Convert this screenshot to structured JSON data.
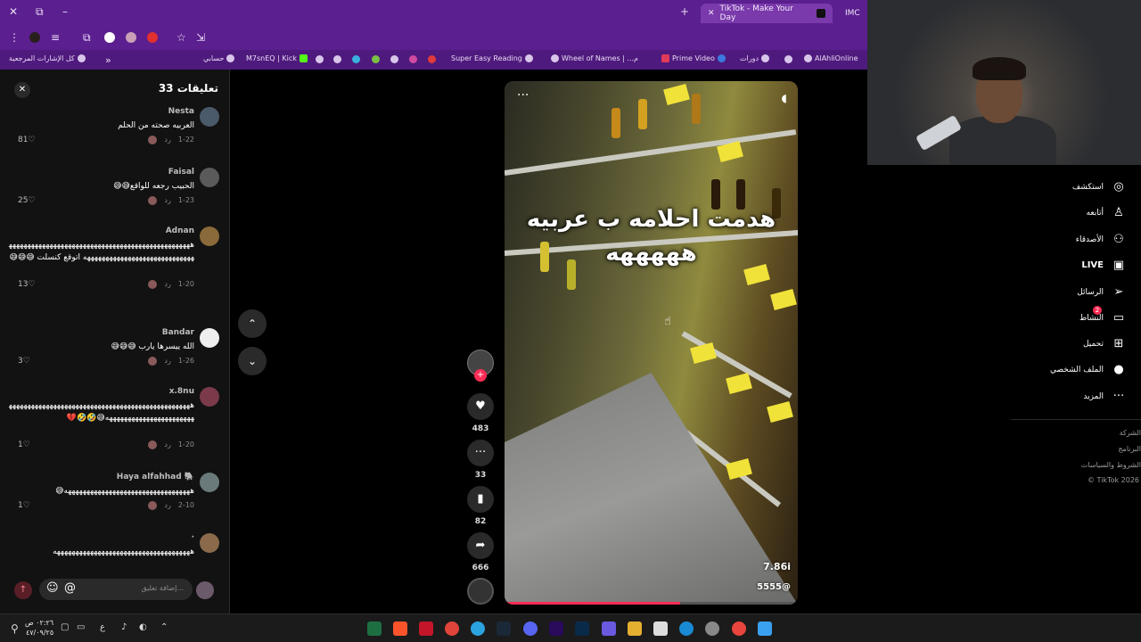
{
  "browser": {
    "active_tab_title": "TikTok - Make Your Day",
    "inactive_tab_title": "IMC",
    "window_controls": {
      "close": "✕",
      "restore": "⧉",
      "minimize": "–",
      "new_tab": "+"
    },
    "bookmarks": [
      "كل الإشارات المرجعية",
      "حسابي",
      "M7snEQ | Kick",
      "Super Easy Reading",
      "Wheel of Names | ...م",
      "Prime Video",
      "دورات",
      "AlAhliOnline"
    ],
    "bookmarks_overflow": "»"
  },
  "comments_panel": {
    "title": "تعليقات 33",
    "close": "✕",
    "reply_label": "رد",
    "items": [
      {
        "name": "Nesta",
        "text": "العربيه صحته من الحلم",
        "date": "1-22",
        "likes": "81",
        "avatar_color": "#4a5a6a"
      },
      {
        "name": "Faisal",
        "text": "الحبيب رجعه للواقع😅😅",
        "date": "1-23",
        "likes": "25",
        "avatar_color": "#5a5a5a"
      },
      {
        "name": "Adnan",
        "text": "هههههههههههههههههههههههههههههههههههههههههههههههههههههههههههههههههههههههههههههههه اتوقع كنسلت 😅😅😅",
        "date": "1-20",
        "likes": "13",
        "avatar_color": "#8a6a3a"
      },
      {
        "name": "Bandar",
        "text": "الله ييسرها يارب 😅😅😅",
        "date": "1-26",
        "likes": "3",
        "avatar_color": "#eeeeee"
      },
      {
        "name": "x.8nu",
        "text": "هههههههههههههههههههههههههههههههههههههههههههههههههههههههههههههههههههههههههه😅🤣🤣💔",
        "date": "1-20",
        "likes": "1",
        "avatar_color": "#7a3a4a"
      },
      {
        "name": "Haya alfahhad 🐘",
        "text": "ههههههههههههههههههههههههههههههههههه😅",
        "date": "2-10",
        "likes": "1",
        "avatar_color": "#6a7a7a"
      },
      {
        "name": "·",
        "text": "هههههههههههههههههههههههههههههههههههههه",
        "date": "",
        "likes": "",
        "avatar_color": "#8a6a4a"
      }
    ],
    "input_placeholder": "إضافة تعليق...",
    "at_symbol": "@",
    "emoji_symbol": "☺",
    "send_symbol": "↑"
  },
  "nav": {
    "up": "⌃",
    "down": "⌄"
  },
  "video": {
    "caption_line1": "هدمت احلامه ب عربيه",
    "caption_line2": "هههههه",
    "view_count": "7.86i",
    "username": "5555@",
    "more": "···",
    "progress": 0.6,
    "likes": "483",
    "comments": "33",
    "saves": "82",
    "shares": "666"
  },
  "right_nav": {
    "items": [
      {
        "label": "استكشف",
        "icon": "compass-icon",
        "glyph": "◎"
      },
      {
        "label": "أتابعه",
        "icon": "user-follow-icon",
        "glyph": "♙"
      },
      {
        "label": "الأصدقاء",
        "icon": "friends-icon",
        "glyph": "⚇"
      },
      {
        "label": "LIVE",
        "icon": "live-tv-icon",
        "glyph": "▣"
      },
      {
        "label": "الرسائل",
        "icon": "send-icon",
        "glyph": "➢"
      },
      {
        "label": "النشاط",
        "icon": "activity-icon",
        "glyph": "▭"
      },
      {
        "label": "تحميل",
        "icon": "upload-icon",
        "glyph": "⊞"
      },
      {
        "label": "الملف الشخصي",
        "icon": "profile-avatar-icon",
        "glyph": "●"
      },
      {
        "label": "المزيد",
        "icon": "more-icon",
        "glyph": "···"
      }
    ],
    "activity_badge": "2",
    "footer": [
      "الشركة",
      "البرنامج",
      "الشروط والسياسات",
      "TikTok 2026 ©"
    ]
  },
  "taskbar": {
    "time": "٠٢:٢٦ ص",
    "date": "٤٧/٠٩/٢٥",
    "lang": "ع"
  }
}
